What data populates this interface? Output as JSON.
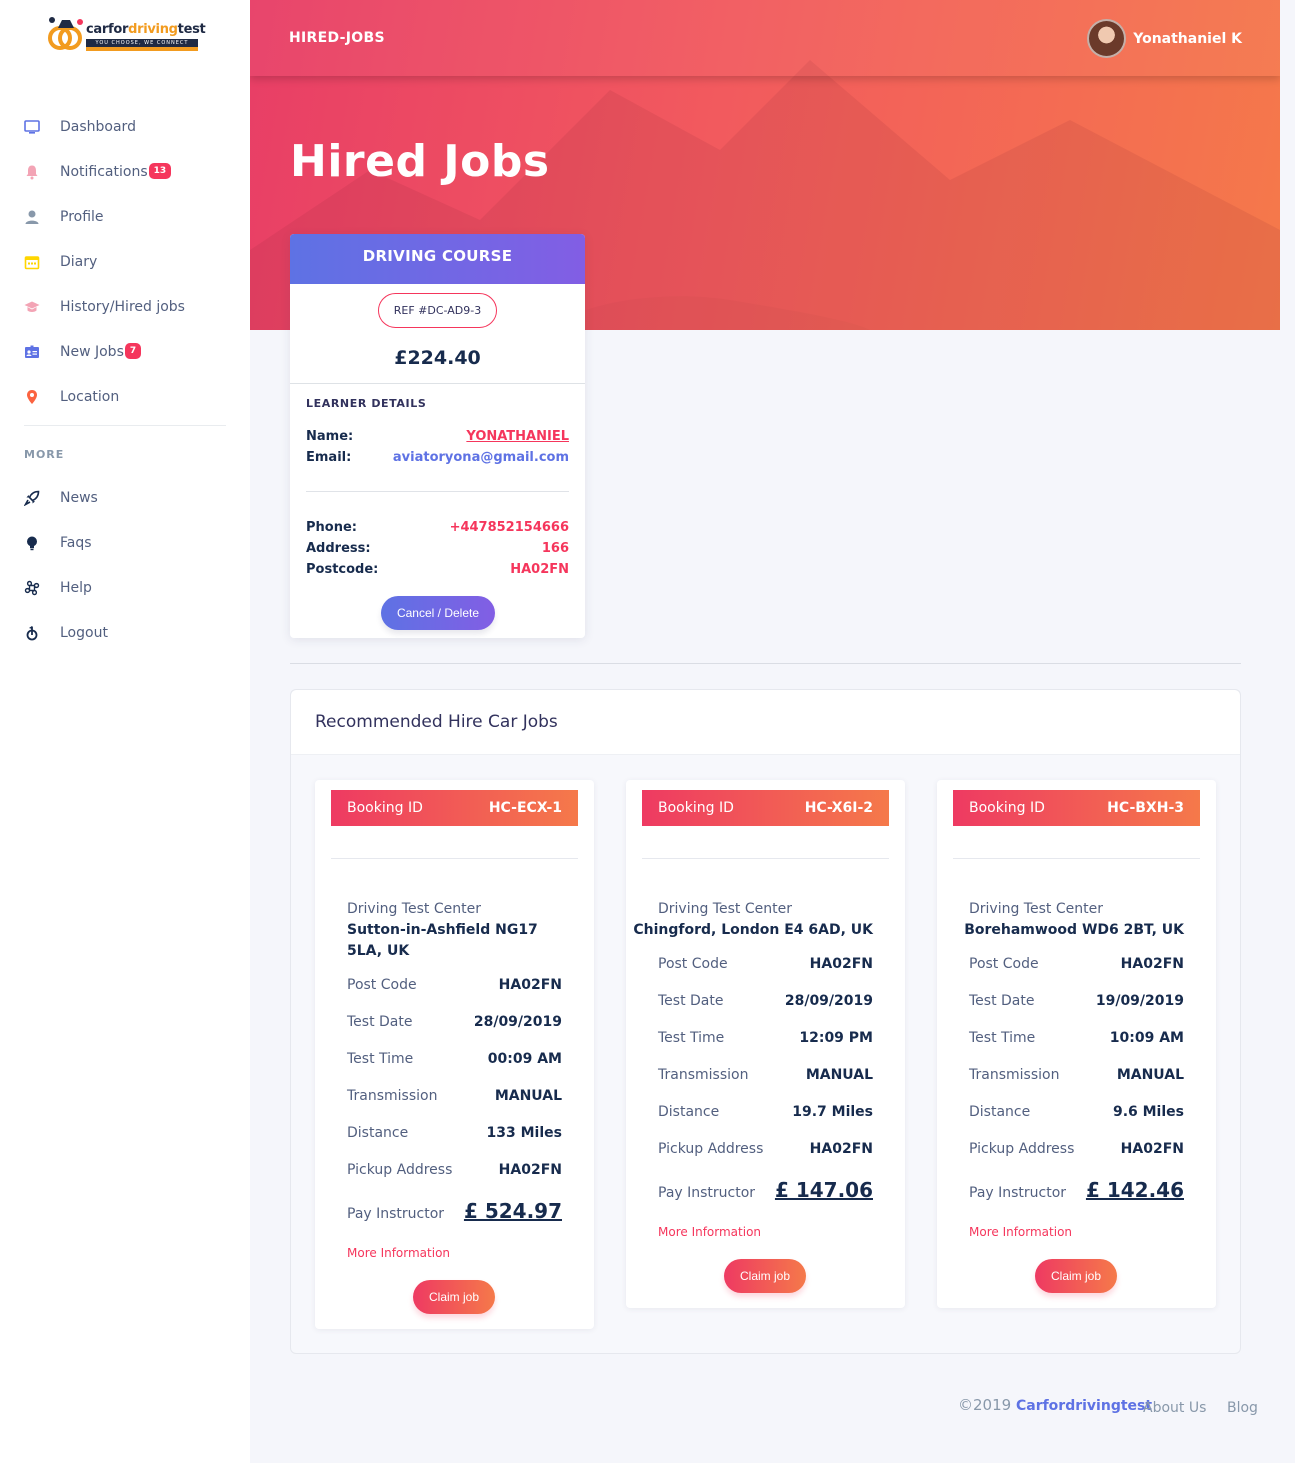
{
  "brand": {
    "logo_text_main": "carfor",
    "logo_text_accent": "driving",
    "logo_text_end": "test",
    "logo_tagline": "YOU CHOOSE, WE CONNECT"
  },
  "sidebar": {
    "items": [
      {
        "label": "Dashboard",
        "icon": "monitor-icon",
        "color": "#5e72e4"
      },
      {
        "label": "Notifications",
        "icon": "bell-icon",
        "color": "#f3a4b5",
        "badge": "13"
      },
      {
        "label": "Profile",
        "icon": "user-icon",
        "color": "#8898aa"
      },
      {
        "label": "Diary",
        "icon": "calendar-icon",
        "color": "#ffd600"
      },
      {
        "label": "History/Hired jobs",
        "icon": "graduation-cap-icon",
        "color": "#f3a4b5"
      },
      {
        "label": "New Jobs",
        "icon": "id-card-icon",
        "color": "#5e72e4",
        "badge": "7"
      },
      {
        "label": "Location",
        "icon": "map-pin-icon",
        "color": "#fb6340"
      }
    ],
    "more_heading": "MORE",
    "more_items": [
      {
        "label": "News",
        "icon": "rocket-icon"
      },
      {
        "label": "Faqs",
        "icon": "bulb-icon"
      },
      {
        "label": "Help",
        "icon": "command-icon"
      },
      {
        "label": "Logout",
        "icon": "logout-icon"
      }
    ]
  },
  "header": {
    "crumb": "HIRED-JOBS",
    "user_name": "Yonathaniel K",
    "title": "Hired Jobs"
  },
  "hired_card": {
    "heading": "DRIVING COURSE",
    "ref": "REF #DC-AD9-3",
    "price": "£224.40",
    "section_title": "LEARNER DETAILS",
    "name_label": "Name:",
    "name_value": "YONATHANIEL",
    "email_label": "Email:",
    "email_value": "aviatoryona@gmail.com",
    "phone_label": "Phone:",
    "phone_value": "+447852154666",
    "address_label": "Address:",
    "address_value": "166",
    "postcode_label": "Postcode:",
    "postcode_value": "HA02FN",
    "cancel_label": "Cancel / Delete"
  },
  "recommended": {
    "title": "Recommended Hire Car Jobs",
    "booking_label": "Booking ID",
    "center_label": "Driving Test Center",
    "labels": {
      "post_code": "Post Code",
      "test_date": "Test Date",
      "test_time": "Test Time",
      "transmission": "Transmission",
      "distance": "Distance",
      "pickup": "Pickup Address",
      "pay": "Pay Instructor"
    },
    "more_label": "More Information",
    "claim_label": "Claim job",
    "jobs": [
      {
        "id": "HC-ECX-1",
        "center": "Sutton-in-Ashfield NG17 5LA, UK",
        "post_code": "HA02FN",
        "test_date": "28/09/2019",
        "test_time": "00:09 AM",
        "transmission": "MANUAL",
        "distance": "133 Miles",
        "pickup": "HA02FN",
        "pay": "£ 524.97"
      },
      {
        "id": "HC-X6I-2",
        "center": "Chingford, London E4 6AD, UK",
        "post_code": "HA02FN",
        "test_date": "28/09/2019",
        "test_time": "12:09 PM",
        "transmission": "MANUAL",
        "distance": "19.7 Miles",
        "pickup": "HA02FN",
        "pay": "£ 147.06"
      },
      {
        "id": "HC-BXH-3",
        "center": "Borehamwood WD6 2BT, UK",
        "post_code": "HA02FN",
        "test_date": "19/09/2019",
        "test_time": "10:09 AM",
        "transmission": "MANUAL",
        "distance": "9.6 Miles",
        "pickup": "HA02FN",
        "pay": "£ 142.46"
      }
    ]
  },
  "footer": {
    "copyright": "©2019",
    "brand": "Carfordrivingtest",
    "about": "About Us",
    "blog": "Blog"
  }
}
